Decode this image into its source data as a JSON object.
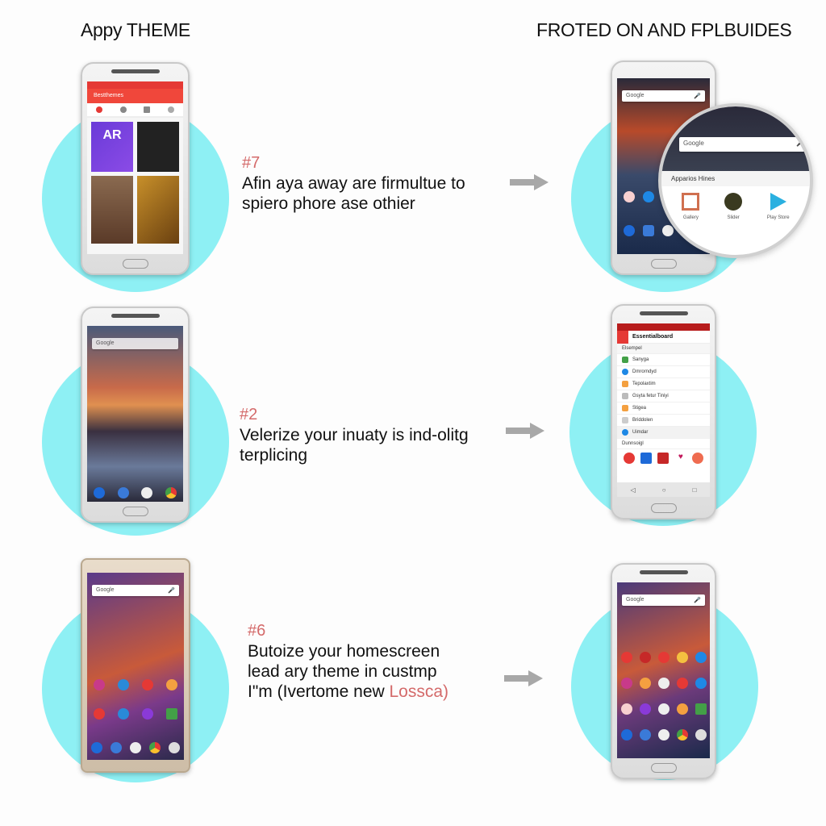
{
  "headings": {
    "left": "Appy THEME",
    "right": "FROTED ON AND FPLBUIDES"
  },
  "colors": {
    "circle": "#8ef0f4",
    "accent_red": "#e53935",
    "step_number": "#d46a6a",
    "arrow": "#a8a8a8"
  },
  "steps": [
    {
      "number": "#7",
      "lines": [
        "Afin aya away are firmultue to",
        "spiero phore ase othier"
      ],
      "icon": "arrow-right-icon"
    },
    {
      "number": "#2",
      "lines": [
        "Velerize your inuaty is ind-olitg",
        "terplicing"
      ],
      "icon": "arrow-right-icon"
    },
    {
      "number": "#6",
      "lines": [
        "Butoize your homescreen",
        "lead ary theme in custmp",
        "I\"m (Ivertome new "
      ],
      "highlight": "Lossca)",
      "icon": "arrow-right-icon"
    }
  ],
  "phone1": {
    "app_title": "Bestthemes",
    "tile1_text": "AR",
    "tabs": [
      "palette-icon",
      "search-icon",
      "grid-icon",
      "info-icon"
    ]
  },
  "phone_search": "Google",
  "magnifier": {
    "search": "Google",
    "section": "Apparios Hines",
    "apps": [
      "Gallery",
      "Slider",
      "Play Store"
    ]
  },
  "phone4": {
    "title": "Essentialboard",
    "section1": "Elsempel",
    "items": [
      "Sanyga",
      "Dmrorndyd",
      "Tepolaxtim",
      "Gsyta fetur Tiniyi",
      "Stigea",
      "Briddolen"
    ],
    "pinned": "Uimdar",
    "section2": "Dunnsoigl"
  }
}
